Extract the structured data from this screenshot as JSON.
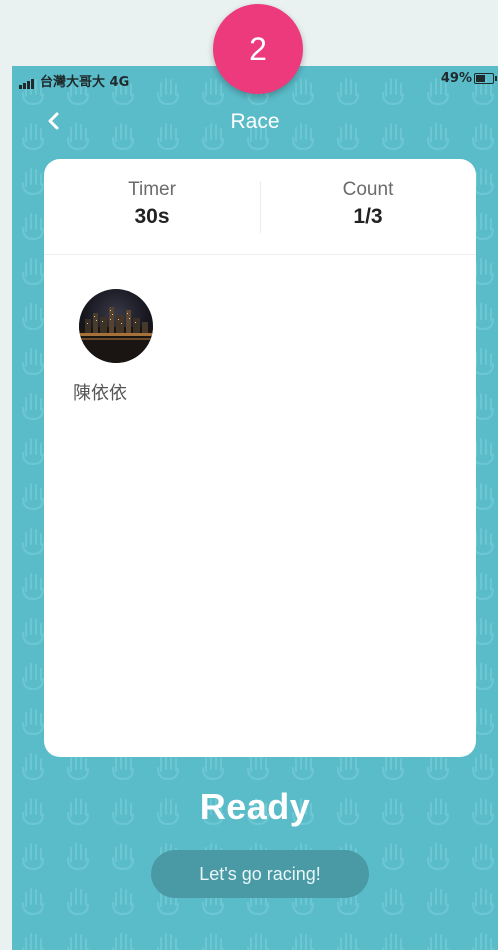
{
  "tutorial": {
    "step_number": "2"
  },
  "status_bar": {
    "carrier": "台灣大哥大 4G",
    "battery": "49%"
  },
  "nav": {
    "title": "Race",
    "back_icon": "chevron-left-icon"
  },
  "stats": {
    "timer": {
      "label": "Timer",
      "value": "30s"
    },
    "count": {
      "label": "Count",
      "value": "1/3"
    }
  },
  "players": [
    {
      "name": "陳依依"
    }
  ],
  "status": {
    "text": "Ready"
  },
  "start": {
    "label": "Let's go racing!"
  },
  "colors": {
    "background": "#5bbcc9",
    "card": "#ffffff",
    "badge": "#ec3a7c",
    "button": "#4a9aa6"
  }
}
